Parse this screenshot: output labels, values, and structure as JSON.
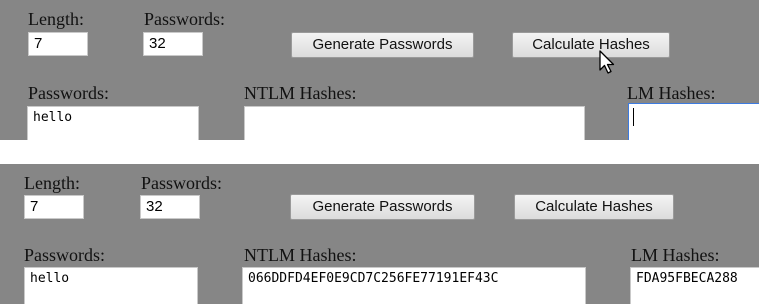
{
  "labels": {
    "length": "Length:",
    "passwords_count": "Passwords:",
    "passwords": "Passwords:",
    "ntlm": "NTLM Hashes:",
    "lm": "LM Hashes:"
  },
  "buttons": {
    "generate": "Generate Passwords",
    "calculate": "Calculate Hashes"
  },
  "before": {
    "length_value": "7",
    "passwords_count_value": "32",
    "passwords_text": "hello",
    "ntlm_text": "",
    "lm_text": ""
  },
  "after": {
    "length_value": "7",
    "passwords_count_value": "32",
    "passwords_text": "hello",
    "ntlm_text": "066DDFD4EF0E9CD7C256FE77191EF43C",
    "lm_text": "FDA95FBECA288"
  },
  "icons": {
    "cursor": "mouse-pointer-icon"
  },
  "colors": {
    "panel": "#868686",
    "focus": "#3d7be0"
  }
}
